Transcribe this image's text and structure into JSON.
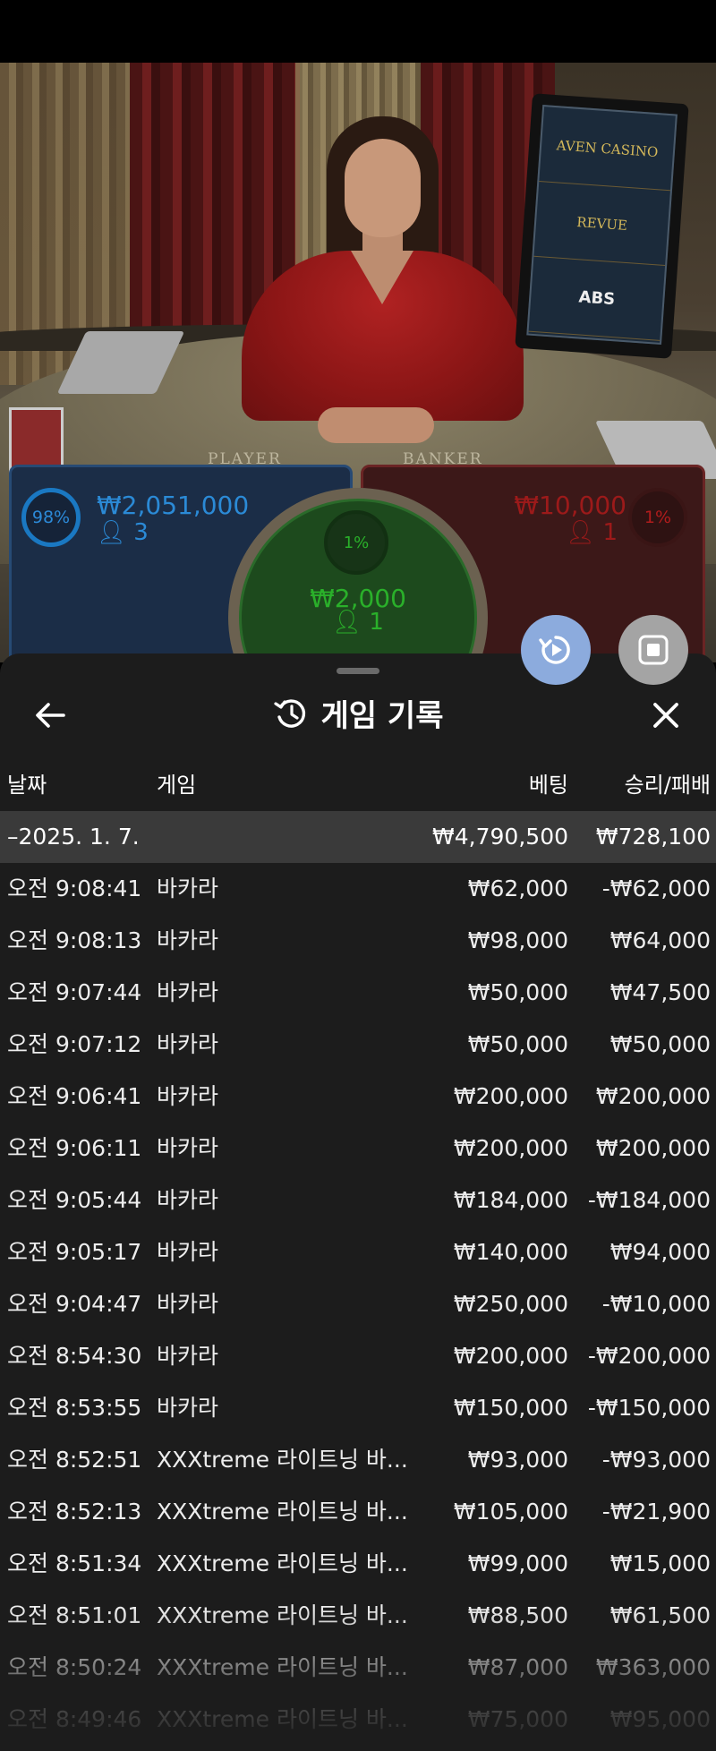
{
  "video": {
    "felt_labels": {
      "player": "PLAYER",
      "banker": "BANKER"
    },
    "screen_sponsors": [
      "AVEN CASINO",
      "REVUE",
      "ABS"
    ]
  },
  "bets": {
    "player": {
      "percent": "98%",
      "amount": "₩2,051,000",
      "count": "3",
      "color": "#2b8ad6"
    },
    "tie": {
      "percent": "1%",
      "amount": "₩2,000",
      "count": "1",
      "color": "#2ab02a"
    },
    "banker": {
      "percent": "1%",
      "amount": "₩10,000",
      "count": "1",
      "color": "#9c1a1a"
    }
  },
  "controls": {
    "replay_icon": "replay-icon",
    "stop_icon": "stop-icon"
  },
  "history": {
    "title": "게임 기록",
    "columns": {
      "date": "날짜",
      "game": "게임",
      "bet": "베팅",
      "result": "승리/패배"
    },
    "summary": {
      "date": "–2025. 1. 7.",
      "bet": "₩4,790,500",
      "result": "₩728,100"
    },
    "rows": [
      {
        "time": "오전 9:08:41",
        "game": "바카라",
        "bet": "₩62,000",
        "result": "-₩62,000"
      },
      {
        "time": "오전 9:08:13",
        "game": "바카라",
        "bet": "₩98,000",
        "result": "₩64,000"
      },
      {
        "time": "오전 9:07:44",
        "game": "바카라",
        "bet": "₩50,000",
        "result": "₩47,500"
      },
      {
        "time": "오전 9:07:12",
        "game": "바카라",
        "bet": "₩50,000",
        "result": "₩50,000"
      },
      {
        "time": "오전 9:06:41",
        "game": "바카라",
        "bet": "₩200,000",
        "result": "₩200,000"
      },
      {
        "time": "오전 9:06:11",
        "game": "바카라",
        "bet": "₩200,000",
        "result": "₩200,000"
      },
      {
        "time": "오전 9:05:44",
        "game": "바카라",
        "bet": "₩184,000",
        "result": "-₩184,000"
      },
      {
        "time": "오전 9:05:17",
        "game": "바카라",
        "bet": "₩140,000",
        "result": "₩94,000"
      },
      {
        "time": "오전 9:04:47",
        "game": "바카라",
        "bet": "₩250,000",
        "result": "-₩10,000"
      },
      {
        "time": "오전 8:54:30",
        "game": "바카라",
        "bet": "₩200,000",
        "result": "-₩200,000"
      },
      {
        "time": "오전 8:53:55",
        "game": "바카라",
        "bet": "₩150,000",
        "result": "-₩150,000"
      },
      {
        "time": "오전 8:52:51",
        "game": "XXXtreme 라이트닝 바...",
        "bet": "₩93,000",
        "result": "-₩93,000"
      },
      {
        "time": "오전 8:52:13",
        "game": "XXXtreme 라이트닝 바...",
        "bet": "₩105,000",
        "result": "-₩21,900"
      },
      {
        "time": "오전 8:51:34",
        "game": "XXXtreme 라이트닝 바...",
        "bet": "₩99,000",
        "result": "₩15,000"
      },
      {
        "time": "오전 8:51:01",
        "game": "XXXtreme 라이트닝 바...",
        "bet": "₩88,500",
        "result": "₩61,500"
      },
      {
        "time": "오전 8:50:24",
        "game": "XXXtreme 라이트닝 바...",
        "bet": "₩87,000",
        "result": "₩363,000"
      },
      {
        "time": "오전 8:49:46",
        "game": "XXXtreme 라이트닝 바...",
        "bet": "₩75,000",
        "result": "₩95,000"
      }
    ]
  }
}
